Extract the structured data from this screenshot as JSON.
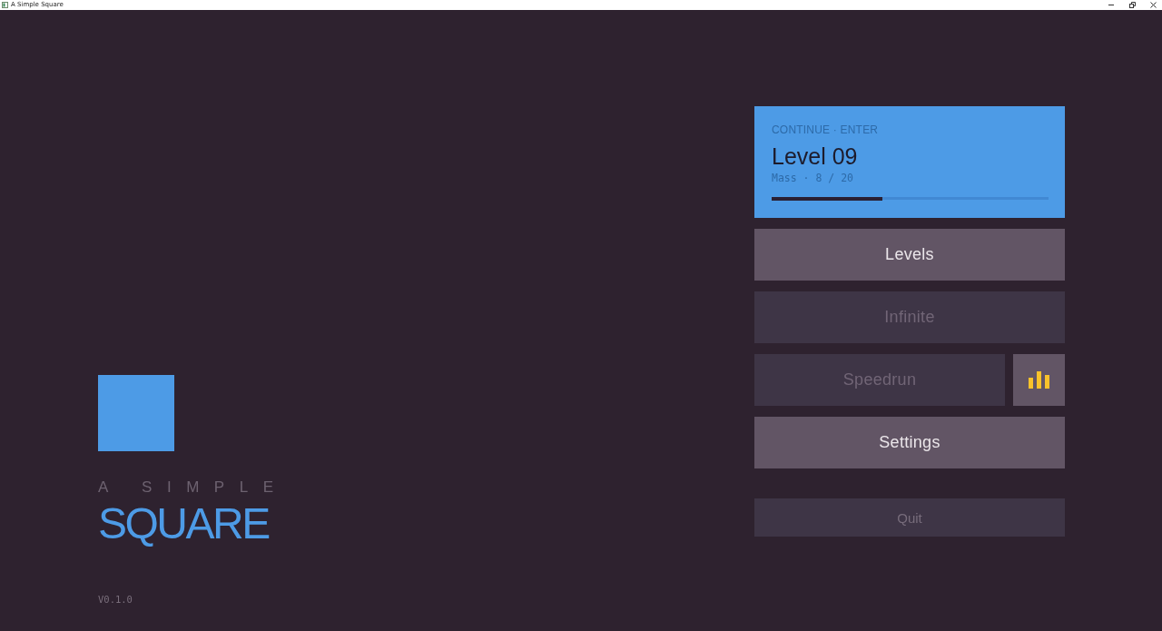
{
  "window": {
    "title": "A Simple Square"
  },
  "logo": {
    "prefix": "A SIMPLE",
    "name": "SQUARE"
  },
  "version": "V0.1.0",
  "continue_card": {
    "hint": "CONTINUE · ENTER",
    "level_name": "Level 09",
    "progress_text": "Mass · 8 / 20",
    "level": 0.4
  },
  "menu": [
    {
      "label": "Levels",
      "disabled": false,
      "stats_button": false
    },
    {
      "label": "Infinite",
      "disabled": true,
      "stats_button": false
    },
    {
      "label": "Speedrun",
      "disabled": true,
      "stats_button": true
    },
    {
      "label": "Settings",
      "disabled": false,
      "stats_button": false
    }
  ],
  "quit": {
    "label": "Quit"
  }
}
